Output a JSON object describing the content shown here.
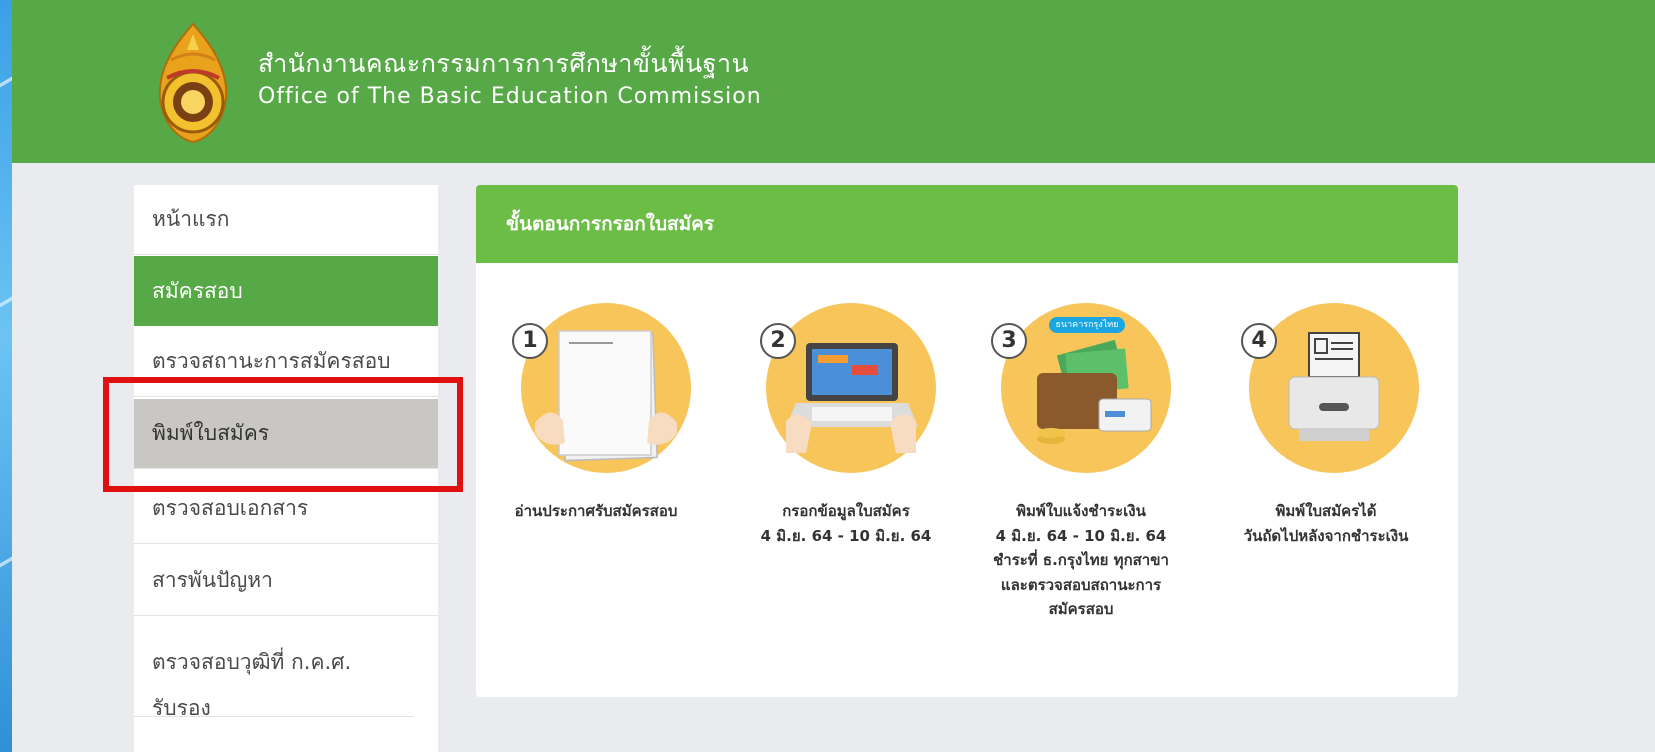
{
  "header": {
    "org_thai": "สำนักงานคณะกรรมการการศึกษาขั้นพื้นฐาน",
    "org_english": "Office of The Basic Education Commission"
  },
  "sidebar": {
    "items": [
      {
        "label": "หน้าแรก"
      },
      {
        "label": "สมัครสอบ"
      },
      {
        "label": "ตรวจสถานะการสมัครสอบ"
      },
      {
        "label": "พิมพ์ใบสมัคร"
      },
      {
        "label": "ตรวจสอบเอกสาร"
      },
      {
        "label": "สารพันปัญหา"
      },
      {
        "label": "ตรวจสอบวุฒิที่ ก.ค.ศ. รับรอง"
      }
    ]
  },
  "panel": {
    "title": "ขั้นตอนการกรอกใบสมัคร",
    "steps": [
      {
        "number": "1",
        "lines": [
          "อ่านประกาศรับสมัครสอบ"
        ]
      },
      {
        "number": "2",
        "lines": [
          "กรอกข้อมูลใบสมัคร",
          "4 มิ.ย. 64 - 10 มิ.ย. 64"
        ]
      },
      {
        "number": "3",
        "lines": [
          "พิมพ์ใบแจ้งชำระเงิน",
          "4 มิ.ย. 64 - 10 มิ.ย. 64",
          "ชำระที่ ธ.กรุงไทย ทุกสาขา",
          "และตรวจสอบสถานะการ",
          "สมัครสอบ"
        ],
        "bank_label": "ธนาคารกรุงไทย"
      },
      {
        "number": "4",
        "lines": [
          "พิมพ์ใบสมัครได้",
          "วันถัดไปหลังจากชำระเงิน"
        ]
      }
    ]
  },
  "colors": {
    "header_green": "#57a846",
    "panel_head_green": "#6cbd45",
    "highlight_red": "#e01010",
    "circle_yellow": "#f8c55a"
  }
}
